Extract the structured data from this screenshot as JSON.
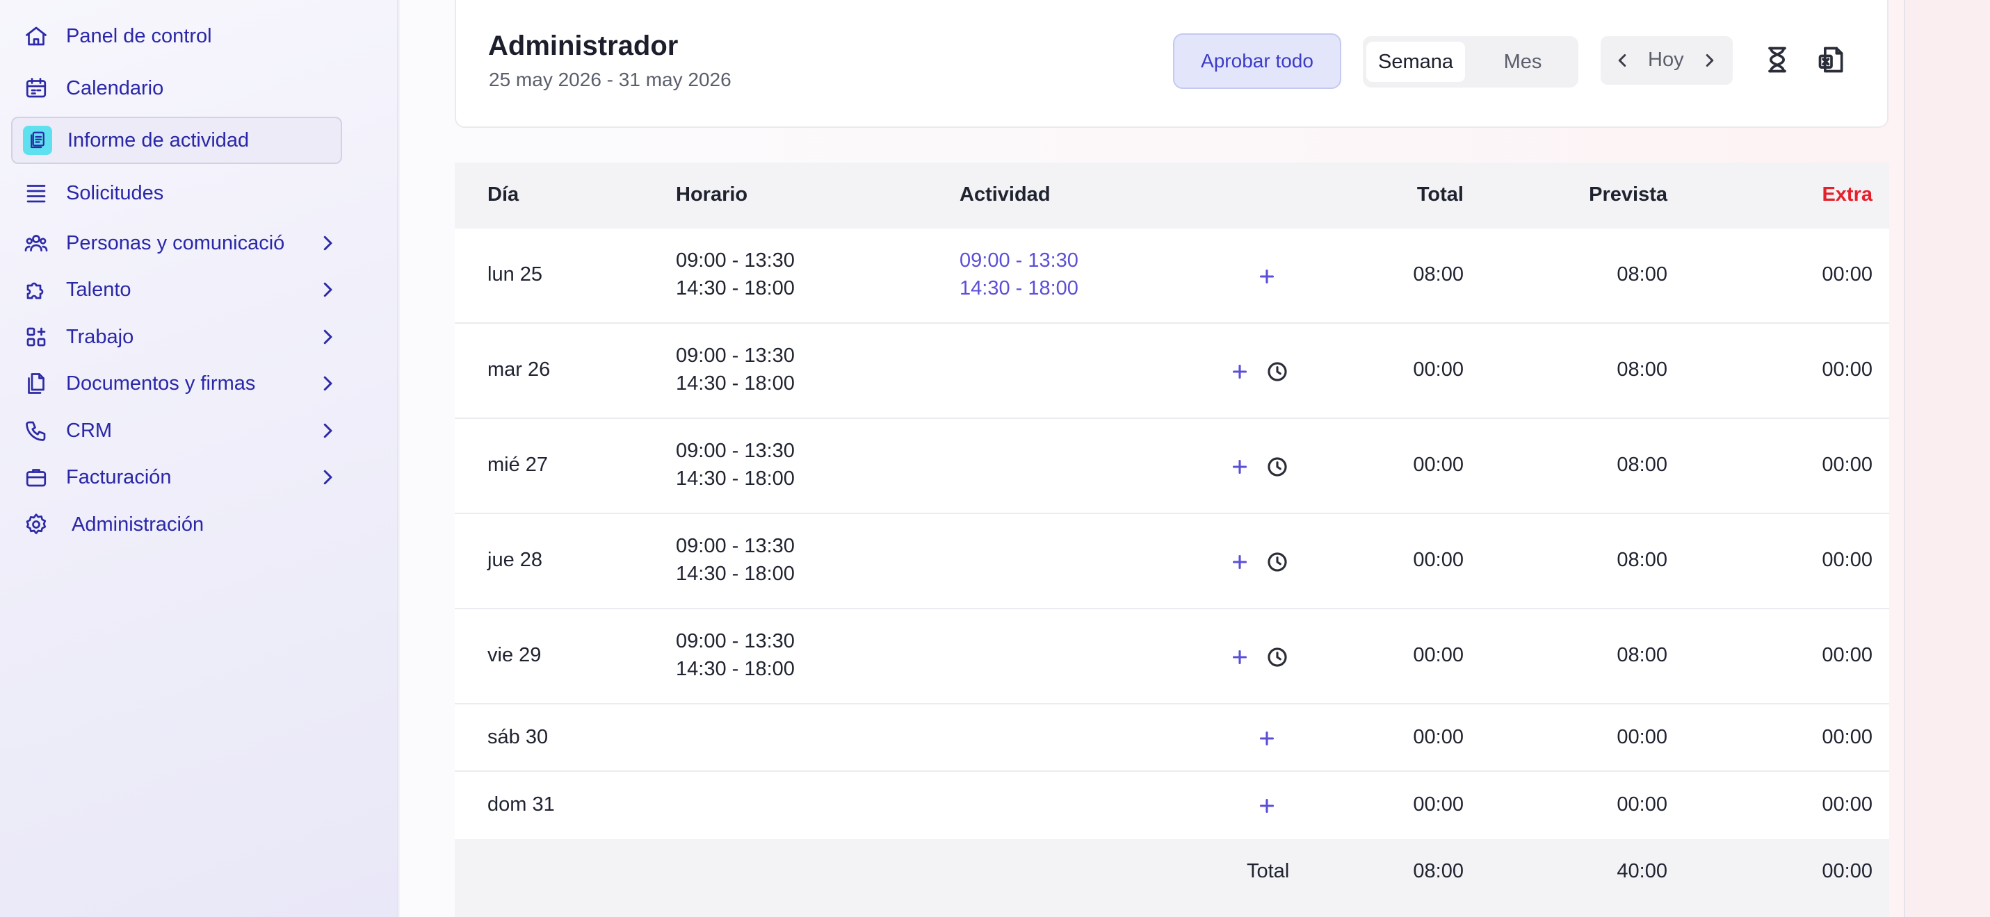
{
  "sidebar": {
    "items": [
      {
        "label": "Panel de control",
        "icon": "home-icon",
        "chevron": false,
        "active": false
      },
      {
        "label": "Calendario",
        "icon": "calendar-icon",
        "chevron": false,
        "active": false
      },
      {
        "label": "Informe de actividad",
        "icon": "report-icon",
        "chevron": false,
        "active": true
      },
      {
        "label": "Solicitudes",
        "icon": "list-icon",
        "chevron": false,
        "active": false
      },
      {
        "label": "Personas y comunicació",
        "icon": "people-icon",
        "chevron": true,
        "active": false
      },
      {
        "label": "Talento",
        "icon": "puzzle-icon",
        "chevron": true,
        "active": false
      },
      {
        "label": "Trabajo",
        "icon": "apps-icon",
        "chevron": true,
        "active": false
      },
      {
        "label": "Documentos y firmas",
        "icon": "documents-icon",
        "chevron": true,
        "active": false
      },
      {
        "label": "CRM",
        "icon": "phone-icon",
        "chevron": true,
        "active": false
      },
      {
        "label": "Facturación",
        "icon": "briefcase-icon",
        "chevron": true,
        "active": false
      },
      {
        "label": "Administración",
        "icon": "gear-icon",
        "chevron": false,
        "active": false
      }
    ]
  },
  "header": {
    "title": "Administrador",
    "date_range": "25 may 2026 - 31 may 2026",
    "approve_all": "Aprobar todo",
    "view_week": "Semana",
    "view_month": "Mes",
    "selected_view": "Semana",
    "today": "Hoy",
    "icons": [
      "hourglass-icon",
      "excel-export-icon"
    ]
  },
  "table": {
    "columns": {
      "day": "Día",
      "schedule": "Horario",
      "activity": "Actividad",
      "total": "Total",
      "planned": "Prevista",
      "extra": "Extra"
    },
    "extra_color": "#e5202b",
    "rows": [
      {
        "day": "lun 25",
        "schedule": [
          "09:00 - 13:30",
          "14:30 - 18:00"
        ],
        "activity": [
          "09:00 - 13:30",
          "14:30 - 18:00"
        ],
        "has_clock": false,
        "total": "08:00",
        "planned": "08:00",
        "extra": "00:00"
      },
      {
        "day": "mar 26",
        "schedule": [
          "09:00 - 13:30",
          "14:30 - 18:00"
        ],
        "activity": [],
        "has_clock": true,
        "total": "00:00",
        "planned": "08:00",
        "extra": "00:00"
      },
      {
        "day": "mié 27",
        "schedule": [
          "09:00 - 13:30",
          "14:30 - 18:00"
        ],
        "activity": [],
        "has_clock": true,
        "total": "00:00",
        "planned": "08:00",
        "extra": "00:00"
      },
      {
        "day": "jue 28",
        "schedule": [
          "09:00 - 13:30",
          "14:30 - 18:00"
        ],
        "activity": [],
        "has_clock": true,
        "total": "00:00",
        "planned": "08:00",
        "extra": "00:00"
      },
      {
        "day": "vie 29",
        "schedule": [
          "09:00 - 13:30",
          "14:30 - 18:00"
        ],
        "activity": [],
        "has_clock": true,
        "total": "00:00",
        "planned": "08:00",
        "extra": "00:00"
      },
      {
        "day": "sáb 30",
        "schedule": [],
        "activity": [],
        "has_clock": false,
        "total": "00:00",
        "planned": "00:00",
        "extra": "00:00"
      },
      {
        "day": "dom 31",
        "schedule": [],
        "activity": [],
        "has_clock": false,
        "total": "00:00",
        "planned": "00:00",
        "extra": "00:00"
      }
    ],
    "footer": {
      "label": "Total",
      "total": "08:00",
      "planned": "40:00",
      "extra": "00:00"
    }
  }
}
